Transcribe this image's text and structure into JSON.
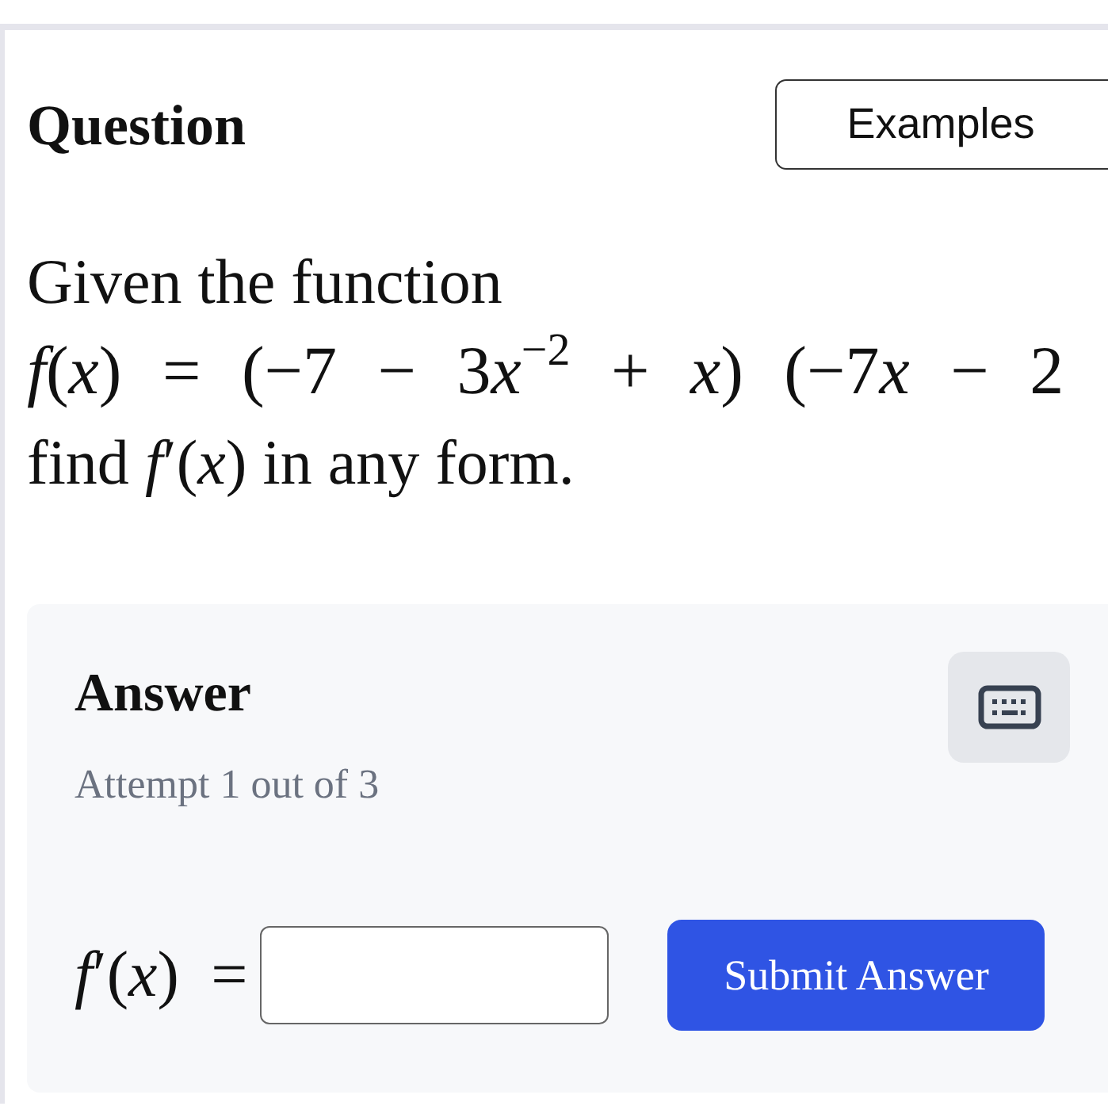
{
  "header": {
    "title": "Question",
    "examples_button": "Examples"
  },
  "question": {
    "intro": "Given the function",
    "formula": [
      {
        "kind": "var",
        "text": "f"
      },
      {
        "kind": "plain",
        "text": "("
      },
      {
        "kind": "var",
        "text": "x"
      },
      {
        "kind": "plain",
        "text": ") = (−7 − 3"
      },
      {
        "kind": "var",
        "text": "x"
      },
      {
        "kind": "sup",
        "text": "−2"
      },
      {
        "kind": "plain",
        "text": " + "
      },
      {
        "kind": "var",
        "text": "x"
      },
      {
        "kind": "plain",
        "text": ") (−7"
      },
      {
        "kind": "var",
        "text": "x"
      },
      {
        "kind": "plain",
        "text": " − 2"
      }
    ],
    "prompt": "find *f*′(*x*) in any form."
  },
  "answer": {
    "title": "Answer",
    "attempt": "Attempt 1 out of 3",
    "input_label": "*f*′(*x*) =",
    "submit_button": "Submit Answer"
  }
}
